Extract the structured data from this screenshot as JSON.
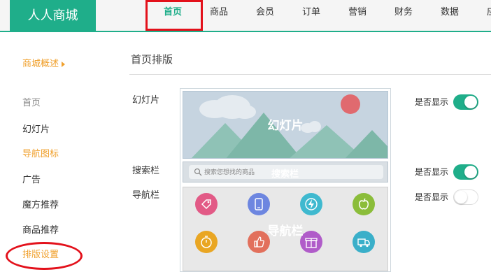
{
  "brand": "人人商城",
  "nav": {
    "items": [
      "首页",
      "商品",
      "会员",
      "订单",
      "营销",
      "财务",
      "数据",
      "应"
    ]
  },
  "sidebar": {
    "header": "商城概述",
    "items": [
      "首页",
      "幻灯片",
      "导航图标",
      "广告",
      "魔方推荐",
      "商品推荐",
      "排版设置"
    ]
  },
  "main": {
    "title": "首页排版",
    "rows": [
      {
        "label": "幻灯片",
        "show_label": "是否显示",
        "toggle": "on"
      },
      {
        "label": "搜索栏",
        "show_label": "是否显示",
        "toggle": "on"
      },
      {
        "label": "导航栏",
        "show_label": "是否显示",
        "toggle": "off"
      }
    ],
    "preview": {
      "slide_label": "幻灯片",
      "search_placeholder": "搜索您想找的商品",
      "search_label": "搜索栏",
      "nav_label": "导航栏",
      "icons": [
        "tag-icon",
        "phone-icon",
        "lightning-icon",
        "apple-icon",
        "stopwatch-icon",
        "thumbs-up-icon",
        "gift-icon",
        "truck-icon"
      ]
    }
  },
  "colors": {
    "accent": "#1fae8a",
    "sidebar_highlight": "#f0a02c",
    "annotation_red": "#e3111b"
  }
}
